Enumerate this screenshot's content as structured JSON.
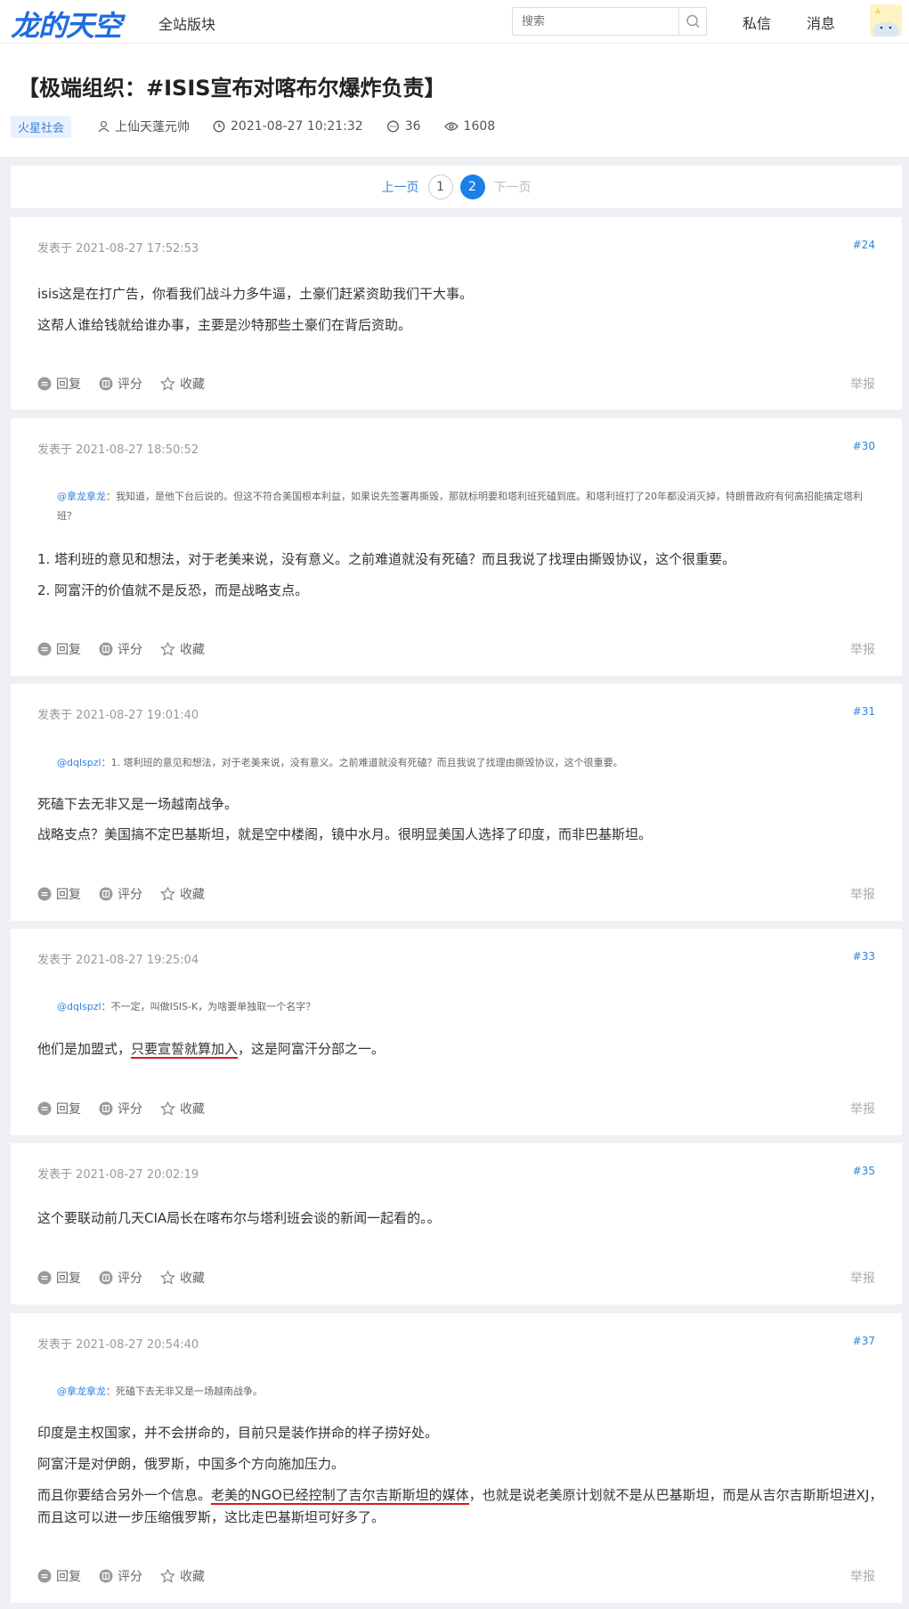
{
  "header": {
    "logo": "龙的天空",
    "nav_all": "全站版块",
    "search_placeholder": "搜索",
    "private_msg": "私信",
    "messages": "消息"
  },
  "thread": {
    "title": "【极端组织：#ISIS宣布对喀布尔爆炸负责】",
    "tag": "火星社会",
    "author": "上仙天蓬元帅",
    "time": "2021-08-27 10:21:32",
    "comments": "36",
    "views": "1608"
  },
  "pager": {
    "prev": "上一页",
    "pages": [
      "1",
      "2"
    ],
    "current": "2",
    "next": "下一页"
  },
  "actions": {
    "reply": "回复",
    "rate": "评分",
    "favorite": "收藏",
    "report": "举报"
  },
  "posts": [
    {
      "date": "发表于 2021-08-27 17:52:53",
      "floor": "#24",
      "lines": [
        "isis这是在打广告，你看我们战斗力多牛逼，土豪们赶紧资助我们干大事。",
        "这帮人谁给钱就给谁办事，主要是沙特那些土豪们在背后资助。"
      ]
    },
    {
      "date": "发表于 2021-08-27 18:50:52",
      "floor": "#30",
      "quote_user": "@拿龙拿龙",
      "quote_text": "：我知道，是他下台后说的。但这不符合美国根本利益，如果说先签署再撕毁，那就标明要和塔利班死磕到底。和塔利班打了20年都没消灭掉，特朗普政府有何高招能搞定塔利班？",
      "lines": [
        "1. 塔利班的意见和想法，对于老美来说，没有意义。之前难道就没有死磕？而且我说了找理由撕毁协议，这个很重要。",
        "2. 阿富汗的价值就不是反恐，而是战略支点。"
      ]
    },
    {
      "date": "发表于 2021-08-27 19:01:40",
      "floor": "#31",
      "quote_user": "@dqlspzl",
      "quote_text": "：1. 塔利班的意见和想法，对于老美来说，没有意义。之前难道就没有死磕？而且我说了找理由撕毁协议，这个很重要。",
      "lines": [
        "死磕下去无非又是一场越南战争。",
        "战略支点？美国搞不定巴基斯坦，就是空中楼阁，镜中水月。很明显美国人选择了印度，而非巴基斯坦。"
      ]
    },
    {
      "date": "发表于 2021-08-27 19:25:04",
      "floor": "#33",
      "quote_user": "@dqlspzl",
      "quote_text": "：不一定，叫做ISIS-K，为啥要单独取一个名字？",
      "line_pre": "他们是加盟式，",
      "line_hl": "只要宣誓就算加入",
      "line_post": "，这是阿富汗分部之一。"
    },
    {
      "date": "发表于 2021-08-27 20:02:19",
      "floor": "#35",
      "lines": [
        "这个要联动前几天CIA局长在喀布尔与塔利班会谈的新闻一起看的。。"
      ]
    },
    {
      "date": "发表于 2021-08-27 20:54:40",
      "floor": "#37",
      "quote_user": "@拿龙拿龙",
      "quote_text": "：死磕下去无非又是一场越南战争。",
      "lines": [
        "印度是主权国家，并不会拼命的，目前只是装作拼命的样子捞好处。",
        "阿富汗是对伊朗，俄罗斯，中国多个方向施加压力。"
      ],
      "line_pre": "而且你要结合另外一个信息。",
      "line_hl": "老美的NGO已经控制了吉尔吉斯斯坦的媒体",
      "line_post": "，也就是说老美原计划就不是从巴基斯坦，而是从吉尔吉斯斯坦进XJ，而且这可以进一步压缩俄罗斯，这比走巴基斯坦可好多了。"
    }
  ]
}
